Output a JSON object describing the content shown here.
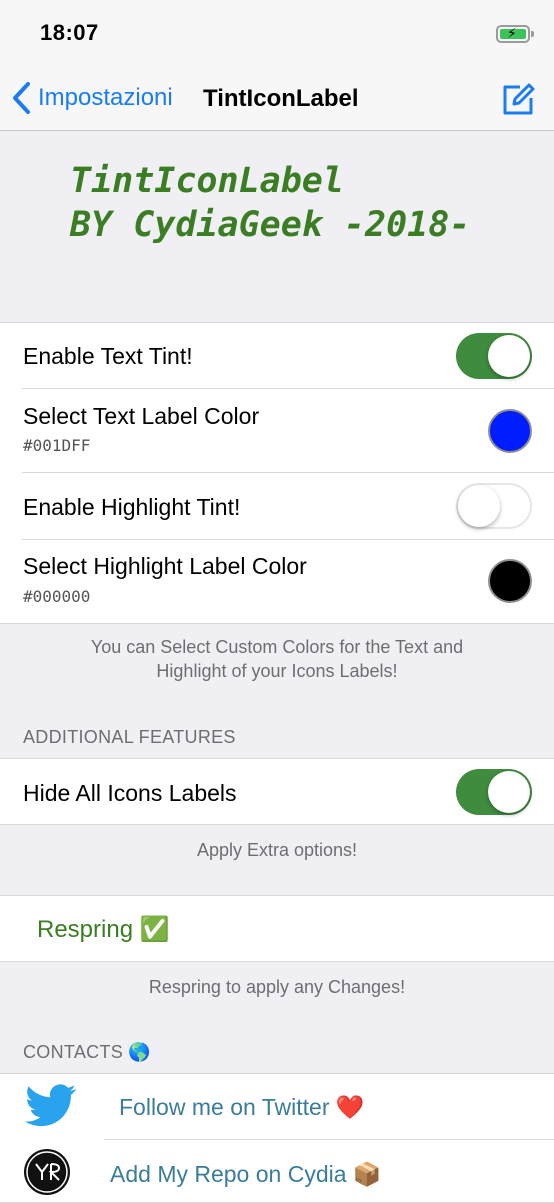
{
  "status": {
    "time": "18:07"
  },
  "nav": {
    "back_label": "Impostazioni",
    "title": "TintIconLabel"
  },
  "banner": {
    "line1": "TintIconLabel",
    "line2": "BY CydiaGeek -2018-"
  },
  "main": {
    "enable_text_tint": {
      "label": "Enable Text Tint!",
      "enabled": true
    },
    "text_color": {
      "label": "Select Text Label Color",
      "value": "#001DFF"
    },
    "enable_highlight_tint": {
      "label": "Enable Highlight Tint!",
      "enabled": false
    },
    "highlight_color": {
      "label": "Select Highlight Label Color",
      "value": "#000000"
    },
    "footer_line1": "You can Select Custom Colors for the Text and",
    "footer_line2": "Highlight of your Icons Labels!"
  },
  "additional": {
    "header": "ADDITIONAL FEATURES",
    "hide_labels": {
      "label": "Hide All Icons Labels",
      "enabled": true
    },
    "footer": "Apply Extra options!"
  },
  "respring": {
    "label": "Respring ✅",
    "footer": "Respring to apply any Changes!"
  },
  "contacts": {
    "header": "CONTACTS 🌎",
    "twitter": {
      "label": "Follow me on Twitter ❤️",
      "icon": "twitter-bird-icon"
    },
    "repo": {
      "label": "Add My Repo on Cydia 📦",
      "icon": "repo-logo-icon"
    }
  },
  "colors": {
    "accent": "#1a7cf5",
    "toggle_on": "#3f8c3f",
    "banner_text": "#3a7d23",
    "link_text": "#3a7d9b",
    "respring_text": "#3a7d23"
  }
}
